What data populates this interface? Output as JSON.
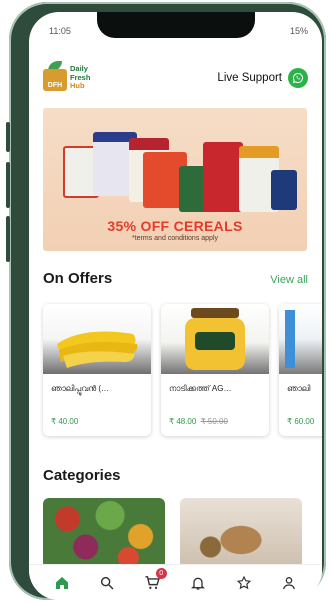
{
  "status_bar": {
    "time": "11:05",
    "battery": "15%"
  },
  "header": {
    "logo_lines": [
      "Daily",
      "Fresh",
      "Hub"
    ],
    "logo_badge": "DFH",
    "support_label": "Live Support"
  },
  "banner": {
    "headline": "35% OFF CEREALS",
    "subtext": "*terms and conditions apply"
  },
  "offers": {
    "title": "On Offers",
    "view_all": "View all",
    "items": [
      {
        "name": "ഞാലിപ്പൂവൻ (…",
        "price": "₹ 40.00",
        "old_price": ""
      },
      {
        "name": "നാടിക്കത്ത് AG…",
        "price": "₹ 48.00",
        "old_price": "₹ 50.00"
      },
      {
        "name": "ഞാലി",
        "price": "₹ 60.00",
        "old_price": ""
      }
    ]
  },
  "categories": {
    "title": "Categories"
  },
  "bottom_nav": {
    "items": [
      "home-icon",
      "search-icon",
      "cart-icon",
      "bell-icon",
      "star-icon",
      "profile-icon"
    ],
    "cart_badge": "0",
    "active_color": "#2e9a4f"
  }
}
